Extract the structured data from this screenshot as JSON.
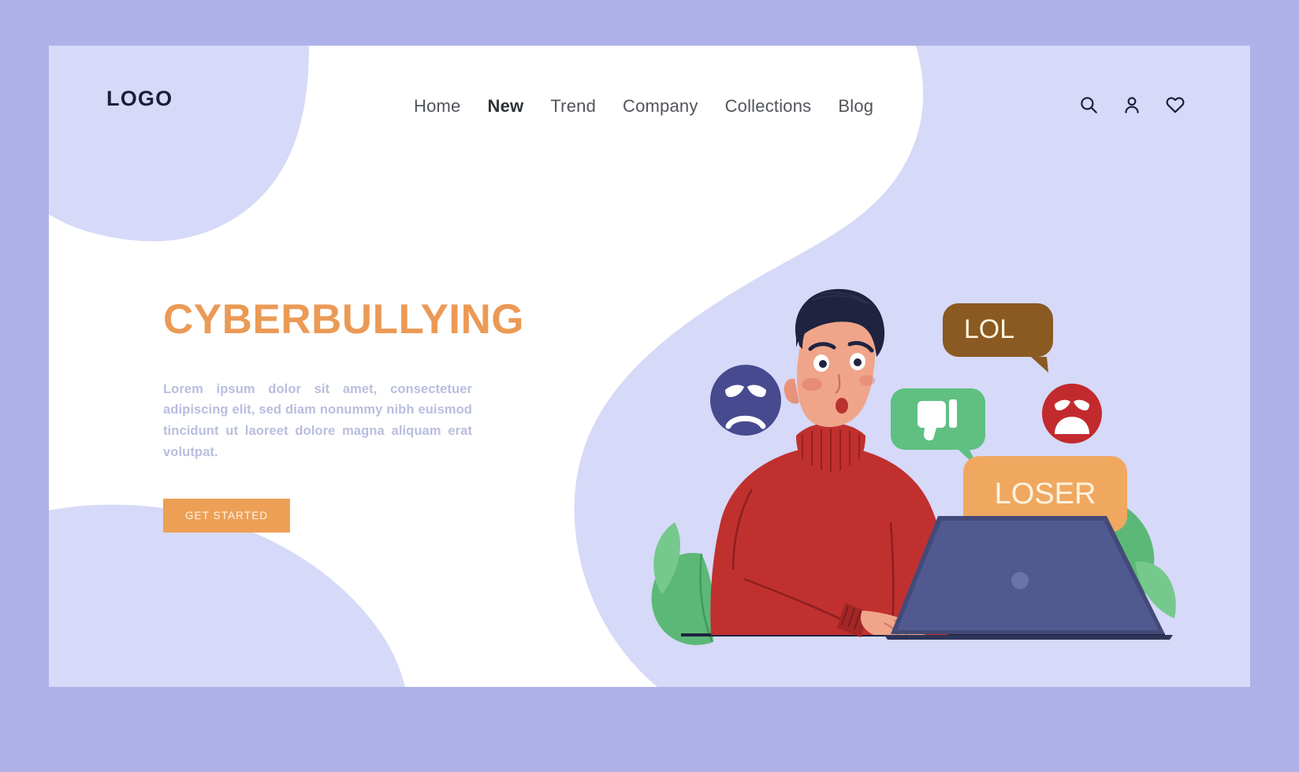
{
  "page": {
    "outer_bg": "#aeb2e8",
    "card_bg": "#ffffff",
    "blob_color": "#d6d9f8",
    "accent": "#eda055"
  },
  "header": {
    "logo": "LOGO",
    "nav": [
      {
        "label": "Home",
        "active": false
      },
      {
        "label": "New",
        "active": true
      },
      {
        "label": "Trend",
        "active": false
      },
      {
        "label": "Company",
        "active": false
      },
      {
        "label": "Collections",
        "active": false
      },
      {
        "label": "Blog",
        "active": false
      }
    ],
    "icons": [
      {
        "name": "search-icon"
      },
      {
        "name": "user-icon"
      },
      {
        "name": "heart-icon"
      }
    ]
  },
  "hero": {
    "title": "CYBERBULLYING",
    "body": "Lorem ipsum dolor sit amet, consectetuer adipiscing elit, sed diam nonummy nibh euismod tincidunt ut laoreet dolore magna aliquam erat volutpat.",
    "cta_label": "GET STARTED",
    "title_color": "#eb9a56",
    "body_color": "#b9bede",
    "cta_bg": "#eda055",
    "cta_color": "#fdf4e8"
  },
  "illustration": {
    "alt": "Worried man at laptop surrounded by hostile messages",
    "bubbles": [
      {
        "name": "lol-bubble",
        "text": "LOL",
        "bg": "#8a5a22",
        "color": "#fdf3e0"
      },
      {
        "name": "thumbs-down-bubble",
        "text": "",
        "bg": "#5fc082",
        "color": "#ffffff"
      },
      {
        "name": "loser-bubble",
        "text": "LOSER",
        "bg": "#f0a860",
        "color": "#fdf3e0"
      }
    ],
    "emojis": [
      {
        "name": "angry-face-blue",
        "color": "#474a8e"
      },
      {
        "name": "angry-face-red",
        "color": "#c32a2e"
      }
    ],
    "colors": {
      "sweater": "#c0302f",
      "sweater_dark": "#a32626",
      "skin": "#f0a58a",
      "hair": "#1f2340",
      "laptop": "#434a78",
      "laptop_light": "#5a6292",
      "plant": "#5cb877",
      "desk": "#1f2340"
    }
  }
}
